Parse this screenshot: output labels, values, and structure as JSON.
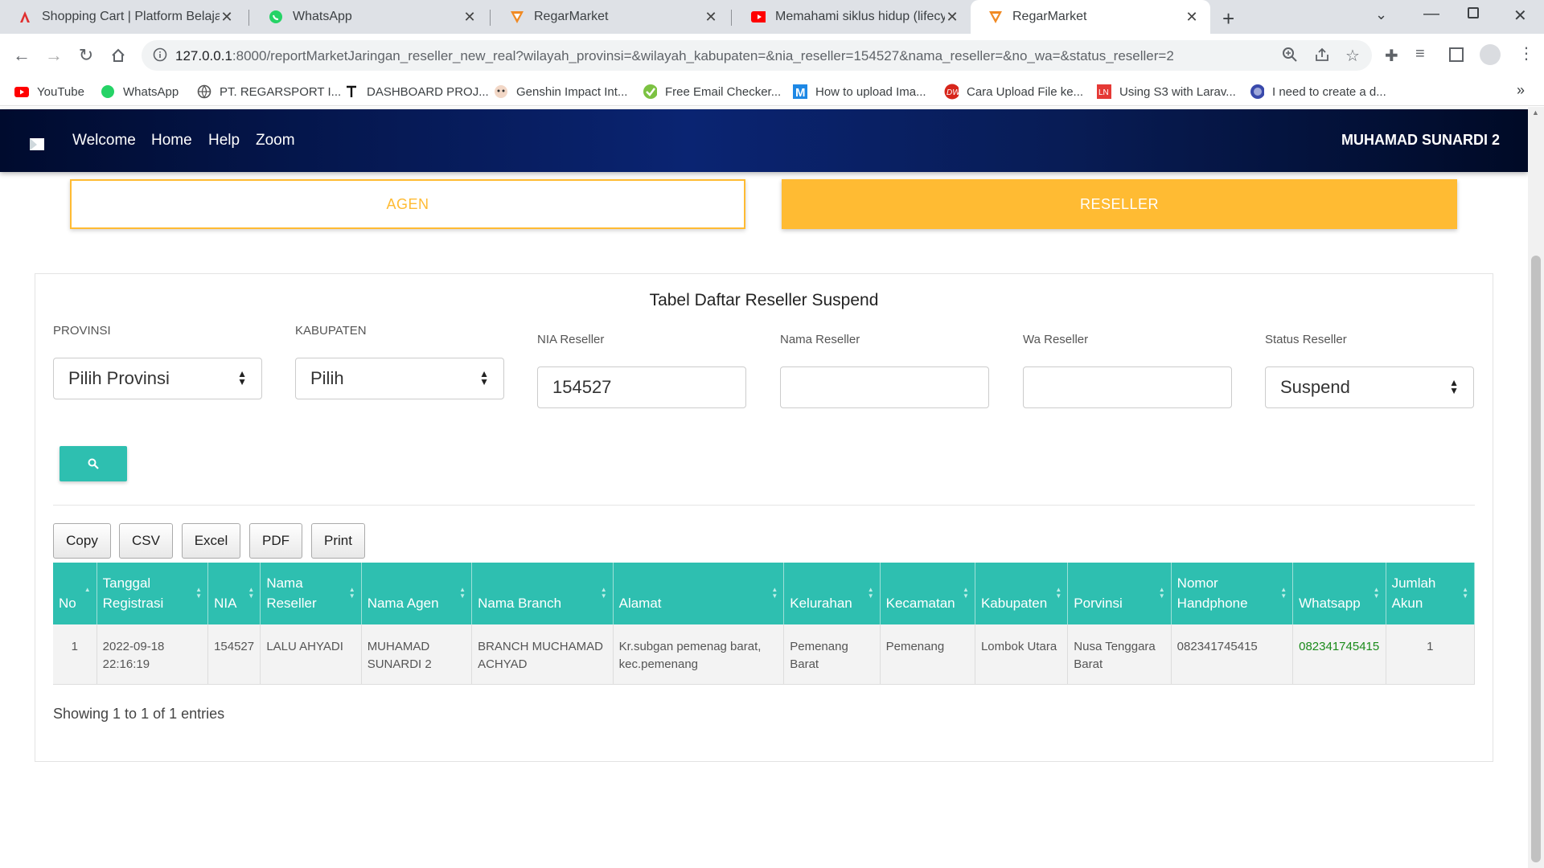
{
  "browser": {
    "tabs": [
      {
        "title": "Shopping Cart | Platform Belajar",
        "active": false
      },
      {
        "title": "WhatsApp",
        "active": false
      },
      {
        "title": "RegarMarket",
        "active": false
      },
      {
        "title": "Memahami siklus hidup (lifecycle",
        "active": false
      },
      {
        "title": "RegarMarket",
        "active": true
      }
    ],
    "url_host": "127.0.0.1",
    "url_path": ":8000/reportMarketJaringan_reseller_new_real?wilayah_provinsi=&wilayah_kabupaten=&nia_reseller=154527&nama_reseller=&no_wa=&status_reseller=2",
    "bookmarks": [
      {
        "label": "YouTube",
        "icon": "youtube-icon"
      },
      {
        "label": "WhatsApp",
        "icon": "whatsapp-icon"
      },
      {
        "label": "PT. REGARSPORT I...",
        "icon": "globe-icon"
      },
      {
        "label": "DASHBOARD PROJ...",
        "icon": "dashboard-icon"
      },
      {
        "label": "Genshin Impact Int...",
        "icon": "genshin-icon"
      },
      {
        "label": "Free Email Checker...",
        "icon": "check-icon"
      },
      {
        "label": "How to upload Ima...",
        "icon": "m-icon"
      },
      {
        "label": "Cara Upload File ke...",
        "icon": "dw-icon"
      },
      {
        "label": "Using S3 with Larav...",
        "icon": "ln-icon"
      },
      {
        "label": "I need to create a d...",
        "icon": "planet-icon"
      }
    ]
  },
  "navbar": {
    "links": [
      "Welcome",
      "Home",
      "Help",
      "Zoom"
    ],
    "user": "MUHAMAD SUNARDI 2"
  },
  "switch": {
    "agen": "AGEN",
    "reseller": "RESELLER"
  },
  "card": {
    "title": "Tabel Daftar Reseller Suspend",
    "filters": {
      "provinsi": {
        "label": "PROVINSI",
        "value": "Pilih Provinsi"
      },
      "kabupaten": {
        "label": "KABUPATEN",
        "value": "Pilih"
      },
      "nia": {
        "label": "NIA Reseller",
        "value": "154527"
      },
      "nama": {
        "label": "Nama Reseller",
        "value": ""
      },
      "wa": {
        "label": "Wa Reseller",
        "value": ""
      },
      "status": {
        "label": "Status Reseller",
        "value": "Suspend"
      }
    },
    "export_buttons": [
      "Copy",
      "CSV",
      "Excel",
      "PDF",
      "Print"
    ],
    "columns": [
      "No",
      "Tanggal Registrasi",
      "NIA",
      "Nama Reseller",
      "Nama Agen",
      "Nama Branch",
      "Alamat",
      "Kelurahan",
      "Kecamatan",
      "Kabupaten",
      "Porvinsi",
      "Nomor Handphone",
      "Whatsapp",
      "Jumlah Akun"
    ],
    "rows": [
      [
        "1",
        "2022-09-18 22:16:19",
        "154527",
        "LALU AHYADI",
        "MUHAMAD SUNARDI 2",
        "BRANCH MUCHAMAD ACHYAD",
        "Kr.subgan pemenag barat, kec.pemenang",
        "Pemenang Barat",
        "Pemenang",
        "Lombok Utara",
        "Nusa Tenggara Barat",
        "082341745415",
        "082341745415",
        "1"
      ]
    ],
    "info": "Showing 1 to 1 of 1 entries"
  },
  "colors": {
    "accent_teal": "#2ebfb0",
    "accent_orange": "#ffbb33",
    "navbar_dark": "#081c55"
  }
}
